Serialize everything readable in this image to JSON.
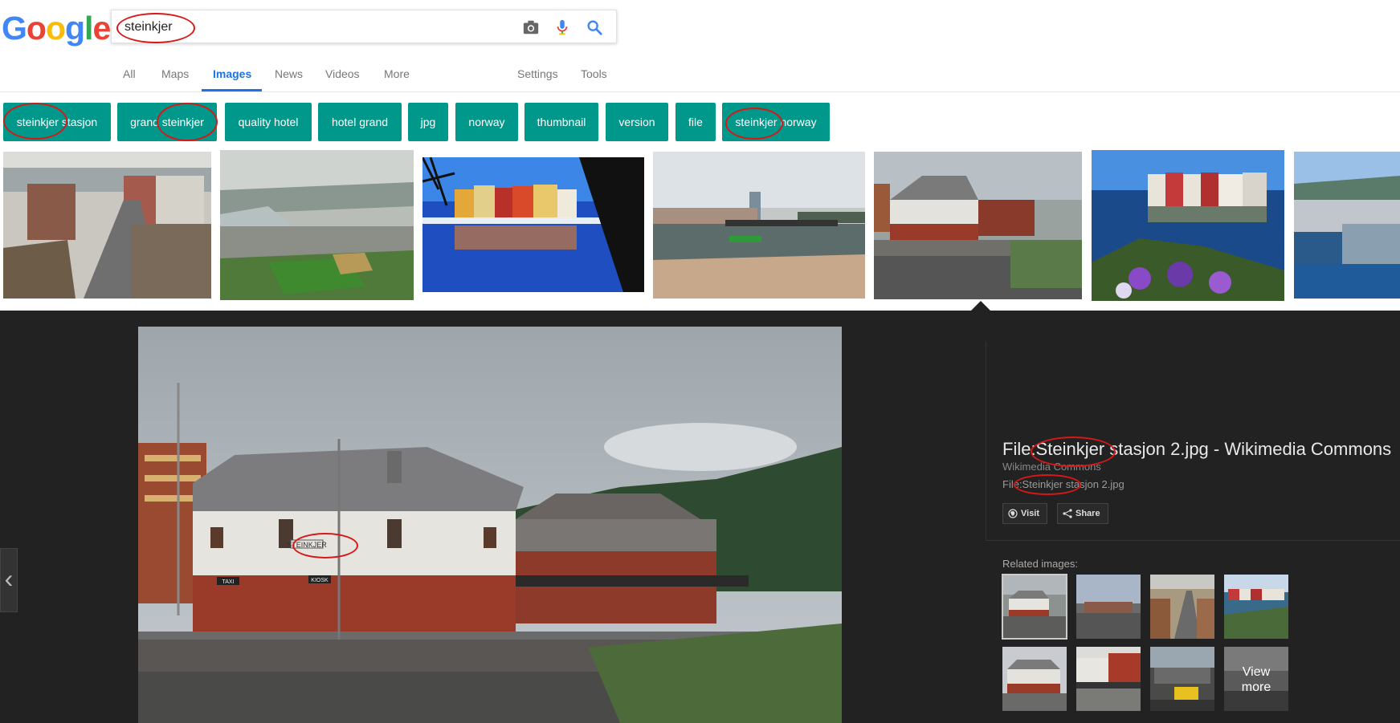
{
  "header": {
    "logo_letters": [
      "G",
      "o",
      "o",
      "g",
      "l",
      "e"
    ],
    "search_value": "steinkjer",
    "icons": [
      "camera-icon",
      "microphone-icon",
      "search-icon"
    ]
  },
  "tabs": {
    "all": "All",
    "maps": "Maps",
    "images": "Images",
    "news": "News",
    "videos": "Videos",
    "more": "More",
    "settings": "Settings",
    "tools": "Tools"
  },
  "chips": [
    "steinkjer stasjon",
    "grand steinkjer",
    "quality hotel",
    "hotel grand",
    "jpg",
    "norway",
    "thumbnail",
    "version",
    "file",
    "steinkjer norway"
  ],
  "preview": {
    "title": "File:Steinkjer stasjon 2.jpg - Wikimedia Commons",
    "source": "Wikimedia Commons",
    "filename": "File:Steinkjer stasjon 2.jpg",
    "visit_label": "Visit",
    "share_label": "Share",
    "related_label": "Related images:",
    "view_more_line1": "View",
    "view_more_line2": "more",
    "building_sign": "STEINKJER",
    "taxi_sign": "TAXI",
    "kiosk_sign": "KIOSK"
  },
  "colors": {
    "chip": "#00988a",
    "accent": "#1a73e8",
    "panel": "#222222",
    "annotation": "#d81818"
  }
}
